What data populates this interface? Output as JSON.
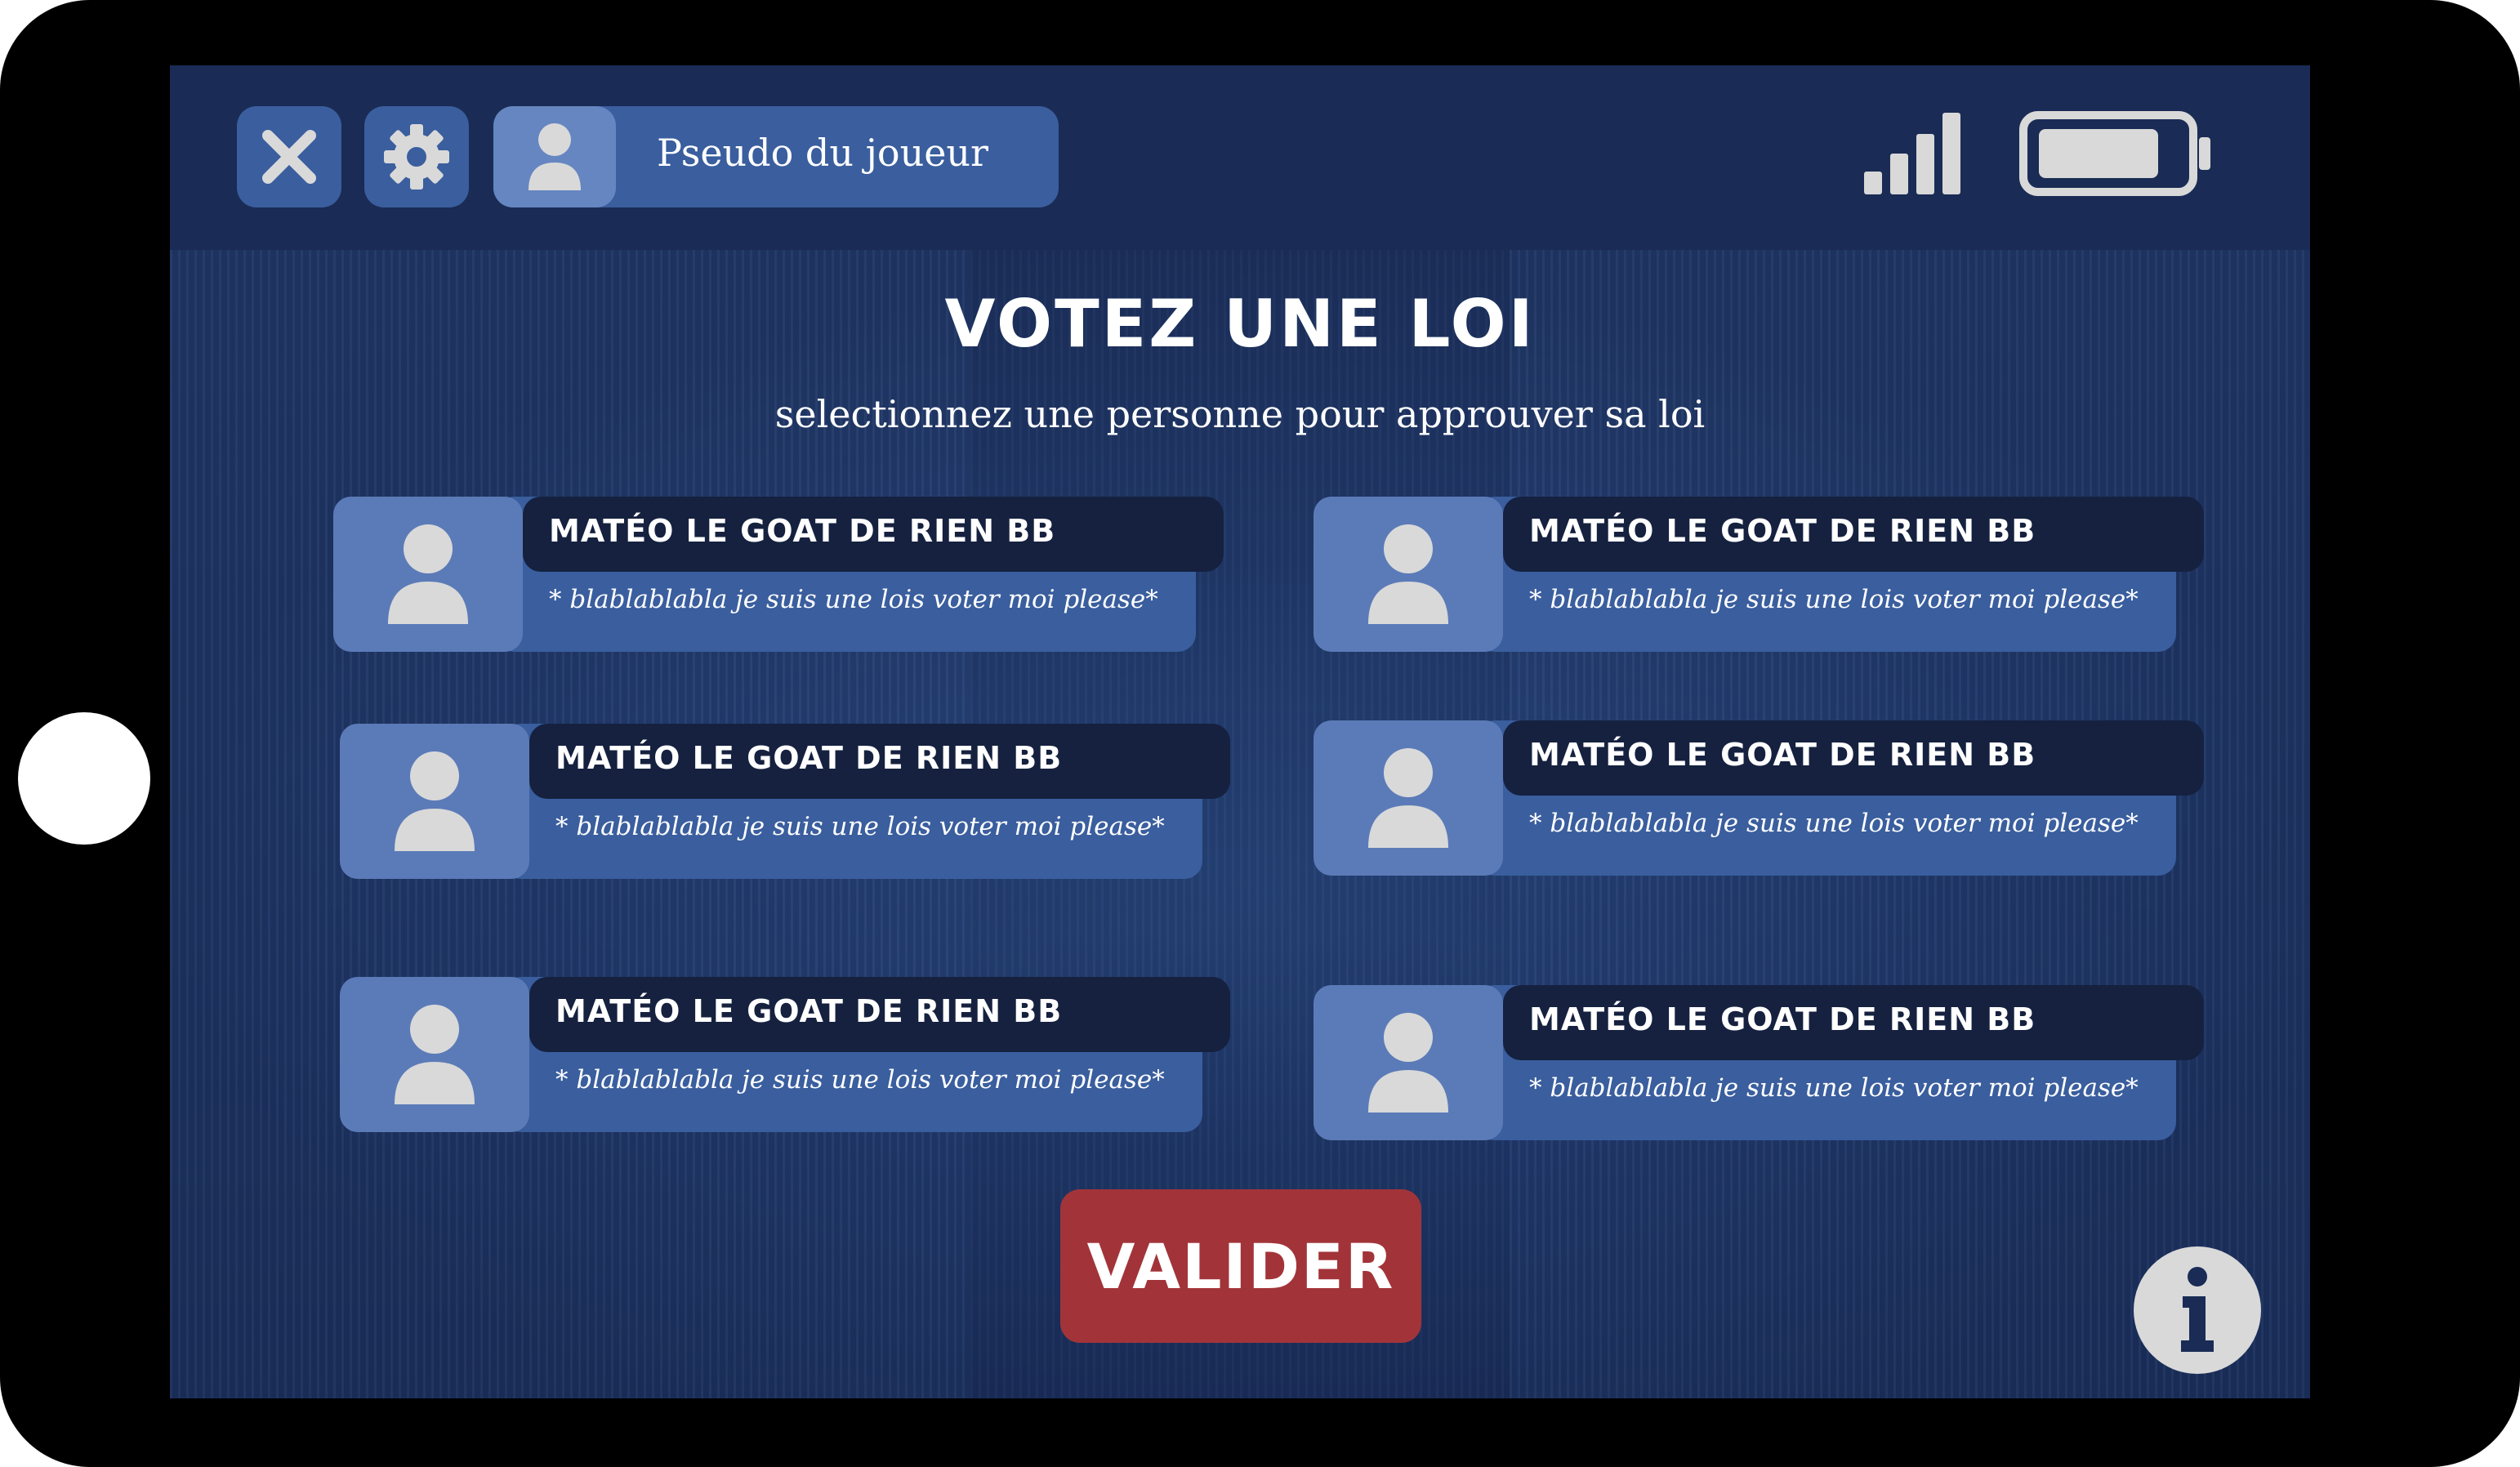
{
  "header": {
    "close_icon": "close-icon",
    "settings_icon": "gear-icon",
    "player_name": "Pseudo du joueur",
    "signal_icon": "signal-icon",
    "battery_icon": "battery-icon"
  },
  "main": {
    "title": "VOTEZ UNE LOI",
    "subtitle": "selectionnez une  personne  pour approuver sa loi",
    "candidates": [
      {
        "name": "MATÉO LE GOAT DE RIEN BB",
        "description": "* blablablabla je suis une lois voter moi please*"
      },
      {
        "name": "MATÉO LE GOAT DE RIEN BB",
        "description": "* blablablabla je suis une lois voter moi please*"
      },
      {
        "name": "MATÉO LE GOAT DE RIEN BB",
        "description": "* blablablabla je suis une lois voter moi please*"
      },
      {
        "name": "MATÉO LE GOAT DE RIEN BB",
        "description": "* blablablabla je suis une lois voter moi please*"
      },
      {
        "name": "MATÉO LE GOAT DE RIEN BB",
        "description": "* blablablabla je suis une lois voter moi please*"
      },
      {
        "name": "MATÉO LE GOAT DE RIEN BB",
        "description": "* blablablabla je suis une lois voter moi please*"
      }
    ],
    "validate_label": "VALIDER",
    "info_icon": "info-icon"
  },
  "colors": {
    "screen_bg": "#2d4d85",
    "topbar": "#1a2c55",
    "button": "#3a5e9e",
    "avatar": "#5b7bb8",
    "name_bar": "#15213f",
    "validate": "#a23439",
    "icon_light": "#d9d9d9"
  }
}
